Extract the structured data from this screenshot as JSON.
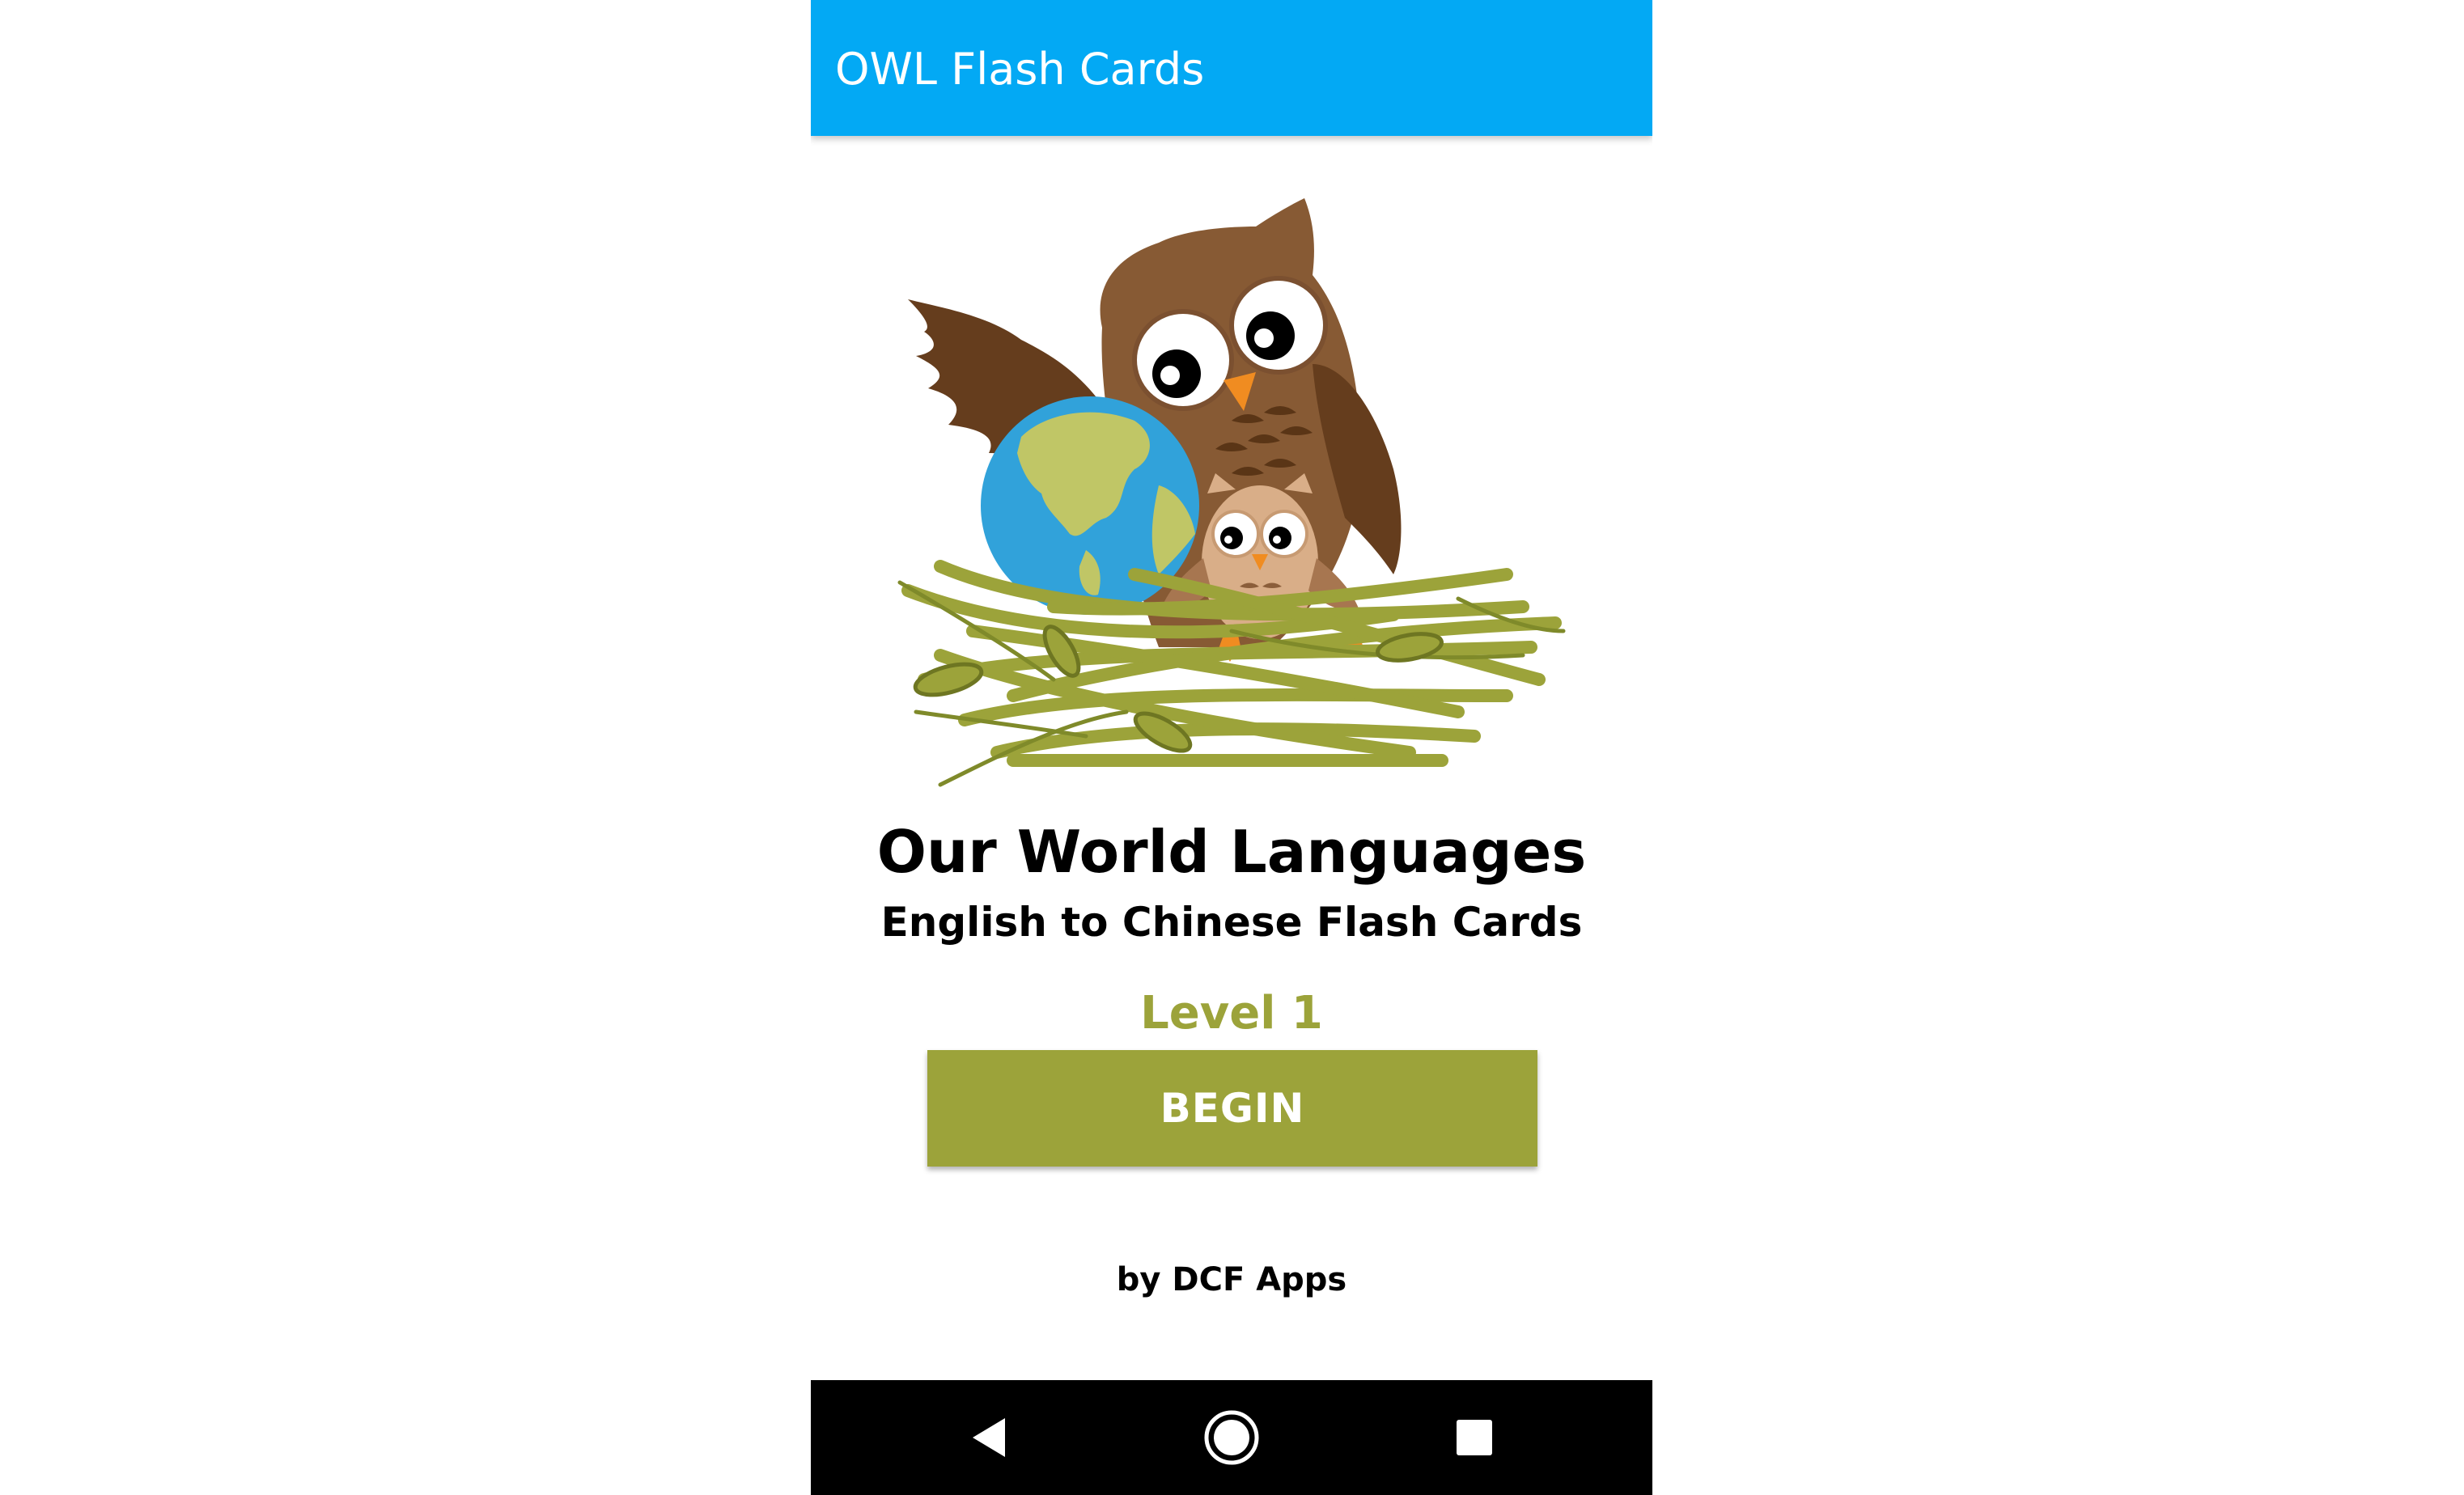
{
  "app_bar": {
    "title": "OWL Flash Cards",
    "color": "#03a9f4"
  },
  "main": {
    "logo_icon": "owl-with-globe-in-nest-icon",
    "title": "Our World Languages",
    "subtitle": "English to Chinese Flash Cards",
    "level_label": "Level 1",
    "begin_label": "BEGIN",
    "byline": "by DCF Apps",
    "accent_color": "#9ca33a"
  },
  "nav_bar": {
    "icons": [
      "back-icon",
      "home-icon",
      "recents-icon"
    ]
  }
}
